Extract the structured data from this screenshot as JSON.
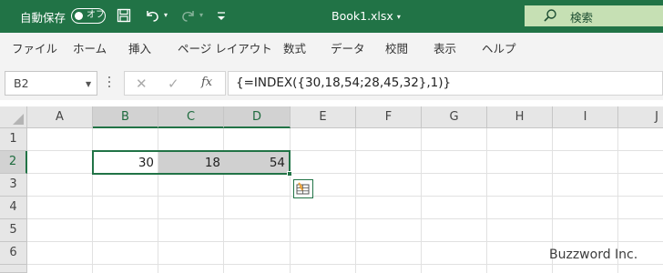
{
  "titlebar": {
    "autosave_label": "自動保存",
    "autosave_state": "オフ",
    "file_name": "Book1.xlsx",
    "search_label": "検索",
    "bg_color": "#217346"
  },
  "menu": {
    "items": [
      "ファイル",
      "ホーム",
      "挿入",
      "ページ レイアウト",
      "数式",
      "データ",
      "校閲",
      "表示",
      "ヘルプ"
    ]
  },
  "formula_bar": {
    "name_box": "B2",
    "formula": "{=INDEX({30,18,54;28,45,32},1)}"
  },
  "grid": {
    "columns": [
      "A",
      "B",
      "C",
      "D",
      "E",
      "F",
      "G",
      "H",
      "I",
      "J"
    ],
    "rows": [
      "1",
      "2",
      "3",
      "4",
      "5",
      "6"
    ],
    "selected_columns": [
      "B",
      "C",
      "D"
    ],
    "selected_row": "2",
    "cells": {
      "B2": "30",
      "C2": "18",
      "D2": "54"
    },
    "accent_color": "#217346"
  },
  "watermark": "Buzzword Inc."
}
